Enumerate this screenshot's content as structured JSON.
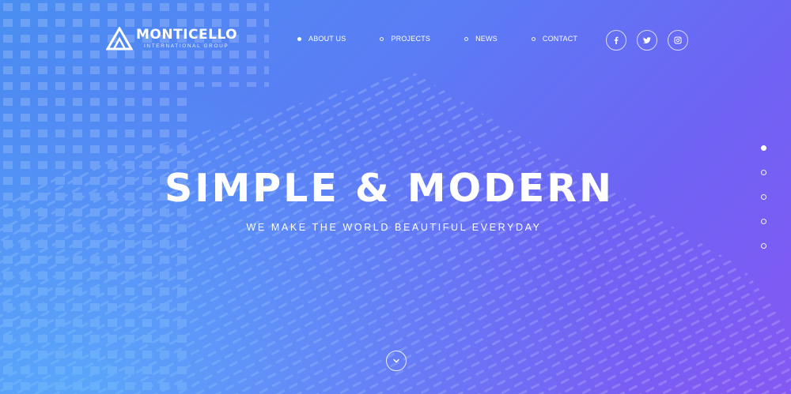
{
  "brand": {
    "name": "MONTICELLO",
    "tagline": "INTERNATIONAL GROUP"
  },
  "nav": {
    "items": [
      {
        "label": "ABOUT US",
        "active": true
      },
      {
        "label": "PROJECTS",
        "active": false
      },
      {
        "label": "NEWS",
        "active": false
      },
      {
        "label": "CONTACT",
        "active": false
      }
    ]
  },
  "social": {
    "icons": [
      "facebook-icon",
      "twitter-icon",
      "instagram-icon"
    ]
  },
  "hero": {
    "headline": "SIMPLE & MODERN",
    "subline": "WE MAKE THE WORLD BEAUTIFUL EVERYDAY"
  },
  "pager": {
    "count": 5,
    "active_index": 0
  },
  "colors": {
    "gradient_start": "#4a8ff2",
    "gradient_end": "#8458f3",
    "text": "#ffffff"
  }
}
